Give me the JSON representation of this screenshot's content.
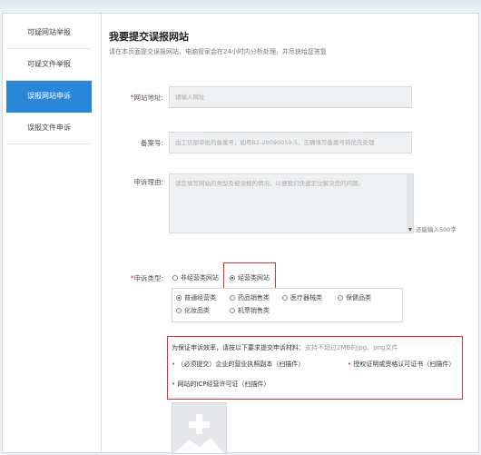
{
  "sidebar": {
    "items": [
      {
        "label": "可疑网站举报",
        "active": false
      },
      {
        "label": "可疑文件举报",
        "active": false
      },
      {
        "label": "误报网站申诉",
        "active": true
      },
      {
        "label": "误报文件申诉",
        "active": false
      }
    ]
  },
  "header": {
    "title": "我要提交误报网站",
    "subtitle": "请在本页面提交误报网站，电脑管家会在24小时内分析处理，并尽快给您答复"
  },
  "form": {
    "url": {
      "label": "网站地址:",
      "placeholder": "请输入网址"
    },
    "icp": {
      "label": "备案号:",
      "placeholder": "由工信部审批的备案号，如粤B2-20090059-5，正确填写备案号将优先处理"
    },
    "reason": {
      "label": "申诉理由:",
      "placeholder": "请您填写网站的类型及被误报的情况，以便我们快速定位解决您的问题。",
      "counter": "还能输入500字"
    },
    "type": {
      "label": "申诉类型:",
      "options": [
        {
          "label": "非经营类网站",
          "selected": false
        },
        {
          "label": "经营类网站",
          "selected": true
        }
      ],
      "suboptions": [
        {
          "label": "普通经营类",
          "selected": true
        },
        {
          "label": "药品销售类",
          "selected": false
        },
        {
          "label": "医疗器械类",
          "selected": false
        },
        {
          "label": "保健品类",
          "selected": false
        },
        {
          "label": "化妆品类",
          "selected": false
        },
        {
          "label": "机票销售类",
          "selected": false
        }
      ]
    },
    "requirements": {
      "intro": "为保证申诉效率，请按以下要求提交申诉材料：",
      "hint": "支持不超过2MB的jpg、png文件",
      "items": [
        "（必须提交）企业的营业执照副本（扫描件）",
        "授权证明或资格认可证书（扫描件）",
        "网站的ICP经营许可证（扫描件）"
      ]
    },
    "upload": {
      "icon": "plus-icon"
    }
  },
  "colors": {
    "accent": "#2a86d9",
    "highlight": "#e0302b"
  }
}
